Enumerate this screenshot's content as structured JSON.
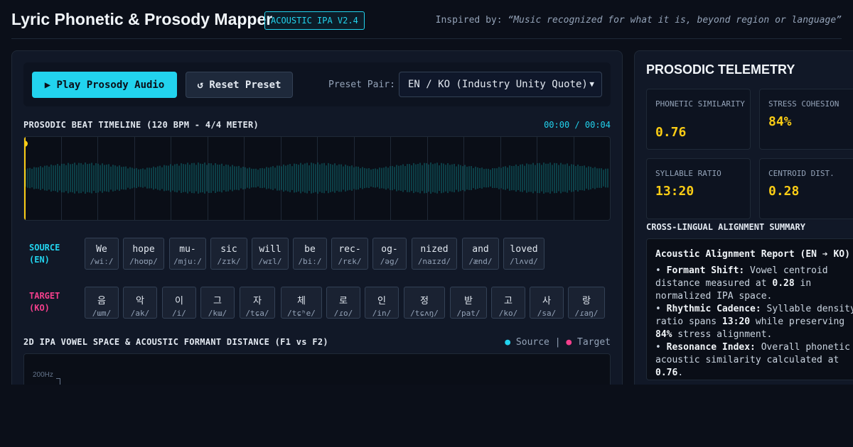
{
  "header": {
    "title": "Lyric Phonetic & Prosody Mapper",
    "version_badge": "ACOUSTIC IPA V2.4",
    "inspired_label": "Inspired by:",
    "inspired_quote": "“Music recognized for what it is, beyond region or language”"
  },
  "controls": {
    "play_label": "▶ Play Prosody Audio",
    "reset_label": "↺ Reset Preset",
    "preset_label": "Preset Pair:",
    "preset_value": "EN / KO (Industry Unity Quote)"
  },
  "timeline": {
    "title": "PROSODIC BEAT TIMELINE (120 BPM - 4/4 METER)",
    "timecode": "00:00 / 00:04",
    "playhead_progress": 0.0
  },
  "source": {
    "label_line1": "SOURCE",
    "label_line2": "(EN)",
    "tokens": [
      {
        "word": "We",
        "ipa": "/wiː/"
      },
      {
        "word": "hope",
        "ipa": "/hoʊp/"
      },
      {
        "word": "mu-",
        "ipa": "/mjuː/"
      },
      {
        "word": "sic",
        "ipa": "/zɪk/"
      },
      {
        "word": "will",
        "ipa": "/wɪl/"
      },
      {
        "word": "be",
        "ipa": "/biː/"
      },
      {
        "word": "rec-",
        "ipa": "/rɛk/"
      },
      {
        "word": "og-",
        "ipa": "/əg/"
      },
      {
        "word": "nized",
        "ipa": "/naɪzd/"
      },
      {
        "word": "and",
        "ipa": "/ænd/"
      },
      {
        "word": "loved",
        "ipa": "/lʌvd/"
      }
    ]
  },
  "target": {
    "label_line1": "TARGET",
    "label_line2": "(KO)",
    "tokens": [
      {
        "word": "음",
        "ipa": "/ɯm/"
      },
      {
        "word": "악",
        "ipa": "/ak/"
      },
      {
        "word": "이",
        "ipa": "/i/"
      },
      {
        "word": "그",
        "ipa": "/kɯ/"
      },
      {
        "word": "자",
        "ipa": "/tɕa/"
      },
      {
        "word": "체",
        "ipa": "/tɕʰe/"
      },
      {
        "word": "로",
        "ipa": "/ɾo/"
      },
      {
        "word": "인",
        "ipa": "/in/"
      },
      {
        "word": "정",
        "ipa": "/tɕʌŋ/"
      },
      {
        "word": "받",
        "ipa": "/pat/"
      },
      {
        "word": "고",
        "ipa": "/ko/"
      },
      {
        "word": "사",
        "ipa": "/sa/"
      },
      {
        "word": "랑",
        "ipa": "/ɾaŋ/"
      }
    ]
  },
  "vowel_space": {
    "title": "2D IPA VOWEL SPACE & ACOUSTIC FORMANT DISTANCE (F1 vs F2)",
    "legend_source": "Source",
    "legend_separator": "|",
    "legend_target": "Target",
    "axis_tick": "200Hz"
  },
  "telemetry": {
    "title": "PROSODIC TELEMETRY",
    "metrics": [
      {
        "label": "PHONETIC SIMILARITY",
        "value": "0.76"
      },
      {
        "label": "STRESS COHESION",
        "value": "84%"
      },
      {
        "label": "SYLLABLE RATIO",
        "value": "13:20"
      },
      {
        "label": "CENTROID DIST.",
        "value": "0.28"
      }
    ]
  },
  "alignment": {
    "title": "CROSS-LINGUAL ALIGNMENT SUMMARY",
    "report_title": "Acoustic Alignment Report (EN ➔ KO)",
    "items": [
      {
        "bullet": "•",
        "label": "Formant Shift:",
        "pre": " Vowel centroid distance measured at ",
        "value": "0.28",
        "post": " in normalized IPA space."
      },
      {
        "bullet": "•",
        "label": "Rhythmic Cadence:",
        "pre": " Syllable density ratio spans ",
        "value": "13:20",
        "mid": " while preserving ",
        "value2": "84%",
        "post": " stress alignment."
      },
      {
        "bullet": "•",
        "label": "Resonance Index:",
        "pre": " Overall phonetic acoustic similarity calculated at ",
        "value": "0.76",
        "post": "."
      }
    ]
  },
  "colors": {
    "accent": "#22d3ee",
    "target": "#f43f8c",
    "metric": "#facc15",
    "background": "#0b0f19"
  }
}
